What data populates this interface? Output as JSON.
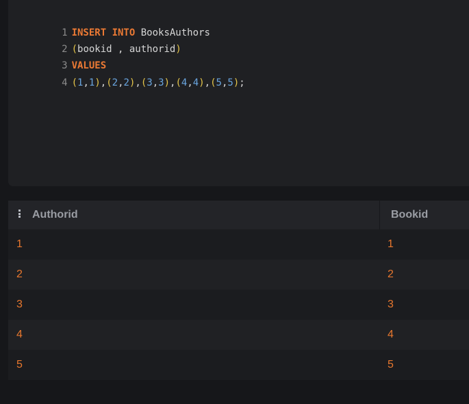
{
  "editor": {
    "lines": [
      {
        "number": "1",
        "tokens": [
          {
            "t": "INSERT INTO",
            "c": "kw"
          },
          {
            "t": " BooksAuthors",
            "c": "txt"
          }
        ]
      },
      {
        "number": "2",
        "tokens": [
          {
            "t": "(",
            "c": "paren"
          },
          {
            "t": "bookid , authorid",
            "c": "txt"
          },
          {
            "t": ")",
            "c": "paren"
          }
        ]
      },
      {
        "number": "3",
        "tokens": [
          {
            "t": "VALUES",
            "c": "kw"
          }
        ]
      },
      {
        "number": "4",
        "tokens": [
          {
            "t": "(",
            "c": "paren"
          },
          {
            "t": "1",
            "c": "num"
          },
          {
            "t": ",",
            "c": "txt"
          },
          {
            "t": "1",
            "c": "num"
          },
          {
            "t": ")",
            "c": "paren"
          },
          {
            "t": ",",
            "c": "txt"
          },
          {
            "t": "(",
            "c": "paren"
          },
          {
            "t": "2",
            "c": "num"
          },
          {
            "t": ",",
            "c": "txt"
          },
          {
            "t": "2",
            "c": "num"
          },
          {
            "t": ")",
            "c": "paren"
          },
          {
            "t": ",",
            "c": "txt"
          },
          {
            "t": "(",
            "c": "paren"
          },
          {
            "t": "3",
            "c": "num"
          },
          {
            "t": ",",
            "c": "txt"
          },
          {
            "t": "3",
            "c": "num"
          },
          {
            "t": ")",
            "c": "paren"
          },
          {
            "t": ",",
            "c": "txt"
          },
          {
            "t": "(",
            "c": "paren"
          },
          {
            "t": "4",
            "c": "num"
          },
          {
            "t": ",",
            "c": "txt"
          },
          {
            "t": "4",
            "c": "num"
          },
          {
            "t": ")",
            "c": "paren"
          },
          {
            "t": ",",
            "c": "txt"
          },
          {
            "t": "(",
            "c": "paren"
          },
          {
            "t": "5",
            "c": "num"
          },
          {
            "t": ",",
            "c": "txt"
          },
          {
            "t": "5",
            "c": "num"
          },
          {
            "t": ")",
            "c": "paren"
          },
          {
            "t": ";",
            "c": "txt"
          }
        ]
      }
    ]
  },
  "results": {
    "columns": [
      "Authorid",
      "Bookid"
    ],
    "column_menu_icon": "column-menu-icon",
    "rows": [
      [
        "1",
        "1"
      ],
      [
        "2",
        "2"
      ],
      [
        "3",
        "3"
      ],
      [
        "4",
        "4"
      ],
      [
        "5",
        "5"
      ]
    ]
  },
  "colors": {
    "keyword": "#ec7a34",
    "number": "#6aa6e0",
    "paren": "#e6c64a",
    "cell_value": "#e8772e",
    "background": "#16171a"
  }
}
